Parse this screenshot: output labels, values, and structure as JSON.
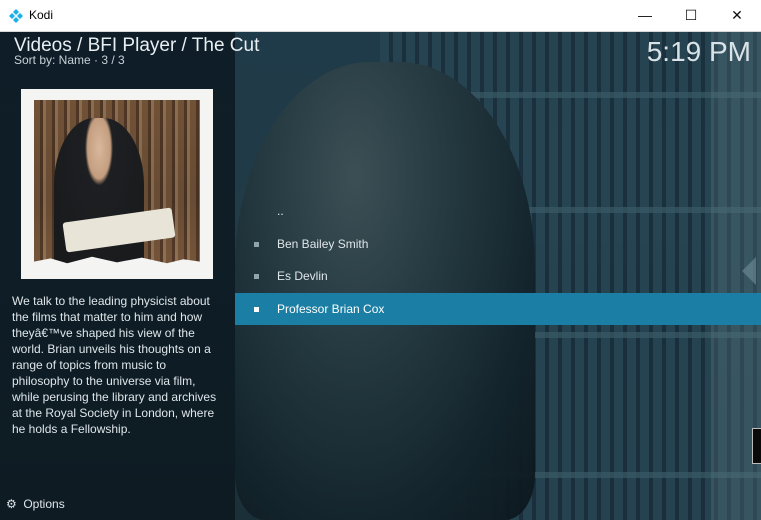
{
  "window": {
    "title": "Kodi",
    "minimize": "—",
    "maximize": "☐",
    "close": "✕"
  },
  "header": {
    "breadcrumb": "Videos / BFI Player / The Cut",
    "sort_info": "Sort by: Name · 3 / 3",
    "clock": "5:19 PM"
  },
  "info": {
    "plot": "We talk to the leading physicist about the films that matter to him and how theyâ€™ve shaped his view of the world. Brian unveils his thoughts on a range of topics from music to philosophy to the universe via film, while perusing the library and archives at the Royal Society in London, where he holds a Fellowship."
  },
  "list": {
    "items": [
      {
        "label": ".."
      },
      {
        "label": "Ben Bailey Smith"
      },
      {
        "label": "Es Devlin"
      },
      {
        "label": "Professor Brian Cox"
      }
    ],
    "selected_index": 3
  },
  "footer": {
    "options_label": "Options"
  },
  "colors": {
    "accent": "#1b7ea4",
    "panel": "#0a161e",
    "text": "#dfe6ea"
  },
  "icons": {
    "app": "kodi-logo-icon",
    "options": "gear-icon"
  }
}
